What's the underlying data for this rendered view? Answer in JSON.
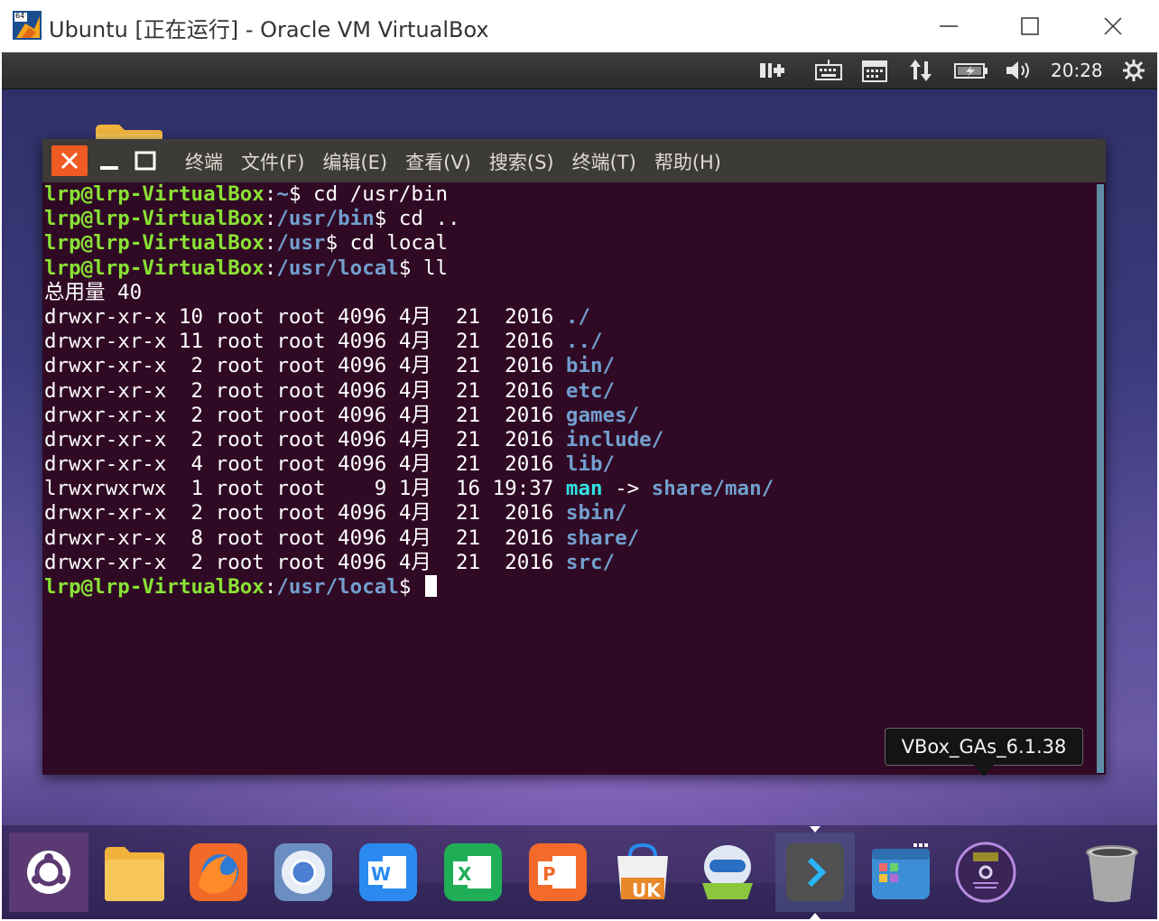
{
  "host": {
    "title": "Ubuntu [正在运行] - Oracle VM VirtualBox",
    "icon_badge": "64"
  },
  "top_panel": {
    "clock": "20:28",
    "icons": [
      "session-switch-icon",
      "keyboard-icon",
      "calendar-icon",
      "network-arrows-icon",
      "battery-icon",
      "volume-icon",
      "settings-gear-icon"
    ]
  },
  "terminal": {
    "menu": [
      "终端",
      "文件(F)",
      "编辑(E)",
      "查看(V)",
      "搜索(S)",
      "终端(T)",
      "帮助(H)"
    ],
    "prompt_user": "lrp@lrp-VirtualBox",
    "lines": [
      {
        "kind": "cmd",
        "path": "~",
        "cmd": " cd /usr/bin"
      },
      {
        "kind": "cmd",
        "path": "/usr/bin",
        "cmd": " cd .."
      },
      {
        "kind": "cmd",
        "path": "/usr",
        "cmd": " cd local"
      },
      {
        "kind": "cmd",
        "path": "/usr/local",
        "cmd": " ll"
      },
      {
        "kind": "text",
        "text": "总用量 40"
      },
      {
        "kind": "ls",
        "meta": "drwxr-xr-x 10 root root 4096 4月  21  2016 ",
        "name": "./",
        "type": "dir"
      },
      {
        "kind": "ls",
        "meta": "drwxr-xr-x 11 root root 4096 4月  21  2016 ",
        "name": "../",
        "type": "dir"
      },
      {
        "kind": "ls",
        "meta": "drwxr-xr-x  2 root root 4096 4月  21  2016 ",
        "name": "bin/",
        "type": "dir"
      },
      {
        "kind": "ls",
        "meta": "drwxr-xr-x  2 root root 4096 4月  21  2016 ",
        "name": "etc/",
        "type": "dir"
      },
      {
        "kind": "ls",
        "meta": "drwxr-xr-x  2 root root 4096 4月  21  2016 ",
        "name": "games/",
        "type": "dir"
      },
      {
        "kind": "ls",
        "meta": "drwxr-xr-x  2 root root 4096 4月  21  2016 ",
        "name": "include/",
        "type": "dir"
      },
      {
        "kind": "ls",
        "meta": "drwxr-xr-x  4 root root 4096 4月  21  2016 ",
        "name": "lib/",
        "type": "dir"
      },
      {
        "kind": "link",
        "meta": "lrwxrwxrwx  1 root root    9 1月  16 19:37 ",
        "name": "man",
        "arrow": " -> ",
        "target": "share/man/"
      },
      {
        "kind": "ls",
        "meta": "drwxr-xr-x  2 root root 4096 4月  21  2016 ",
        "name": "sbin/",
        "type": "dir"
      },
      {
        "kind": "ls",
        "meta": "drwxr-xr-x  8 root root 4096 4月  21  2016 ",
        "name": "share/",
        "type": "dir"
      },
      {
        "kind": "ls",
        "meta": "drwxr-xr-x  2 root root 4096 4月  21  2016 ",
        "name": "src/",
        "type": "dir"
      },
      {
        "kind": "prompt",
        "path": "/usr/local"
      }
    ]
  },
  "tooltip": "VBox_GAs_6.1.38",
  "dock": [
    {
      "name": "ubuntu-dash-icon"
    },
    {
      "name": "files-folder-icon"
    },
    {
      "name": "firefox-icon"
    },
    {
      "name": "chromium-icon"
    },
    {
      "name": "wps-writer-icon"
    },
    {
      "name": "wps-spreadsheet-icon"
    },
    {
      "name": "wps-presentation-icon"
    },
    {
      "name": "ubuntu-kylin-store-icon"
    },
    {
      "name": "software-updater-icon"
    },
    {
      "name": "terminal-icon"
    },
    {
      "name": "file-manager-icon"
    },
    {
      "name": "dvd-disc-icon"
    },
    {
      "name": "trash-icon"
    }
  ],
  "colors": {
    "terminal_bg": "#300a24",
    "prompt_user": "#8ae234",
    "prompt_path": "#729fcf",
    "link": "#34e2e2",
    "close_button": "#f05a23"
  }
}
